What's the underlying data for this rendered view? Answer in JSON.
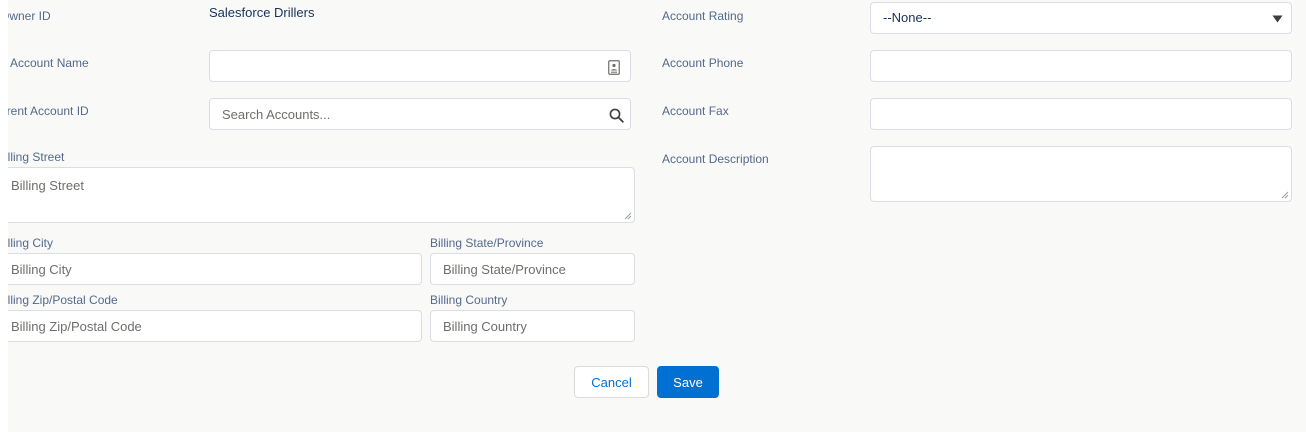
{
  "left": {
    "owner_label": "Owner ID",
    "owner_value": "Salesforce Drillers",
    "account_name_label": "Account Name",
    "account_name_value": "",
    "parent_label": "Parent Account ID",
    "parent_placeholder": "Search Accounts...",
    "billing_street_label": "Billing Street",
    "billing_street_placeholder": "Billing Street",
    "billing_city_label": "Billing City",
    "billing_city_placeholder": "Billing City",
    "billing_state_label": "Billing State/Province",
    "billing_state_placeholder": "Billing State/Province",
    "billing_zip_label": "Billing Zip/Postal Code",
    "billing_zip_placeholder": "Billing Zip/Postal Code",
    "billing_country_label": "Billing Country",
    "billing_country_placeholder": "Billing Country"
  },
  "right": {
    "rating_label": "Account Rating",
    "rating_selected": "--None--",
    "phone_label": "Account Phone",
    "phone_value": "",
    "fax_label": "Account Fax",
    "fax_value": "",
    "description_label": "Account Description",
    "description_value": ""
  },
  "actions": {
    "cancel_label": "Cancel",
    "save_label": "Save"
  },
  "icons": {
    "account_name_field_icon": "contact-card-icon",
    "parent_search_icon": "search-icon",
    "rating_dropdown_icon": "caret-down-icon"
  },
  "colors": {
    "brand": "#0070d2",
    "background": "#f9f9f8",
    "label": "#54698d",
    "border": "#d8dde6"
  }
}
